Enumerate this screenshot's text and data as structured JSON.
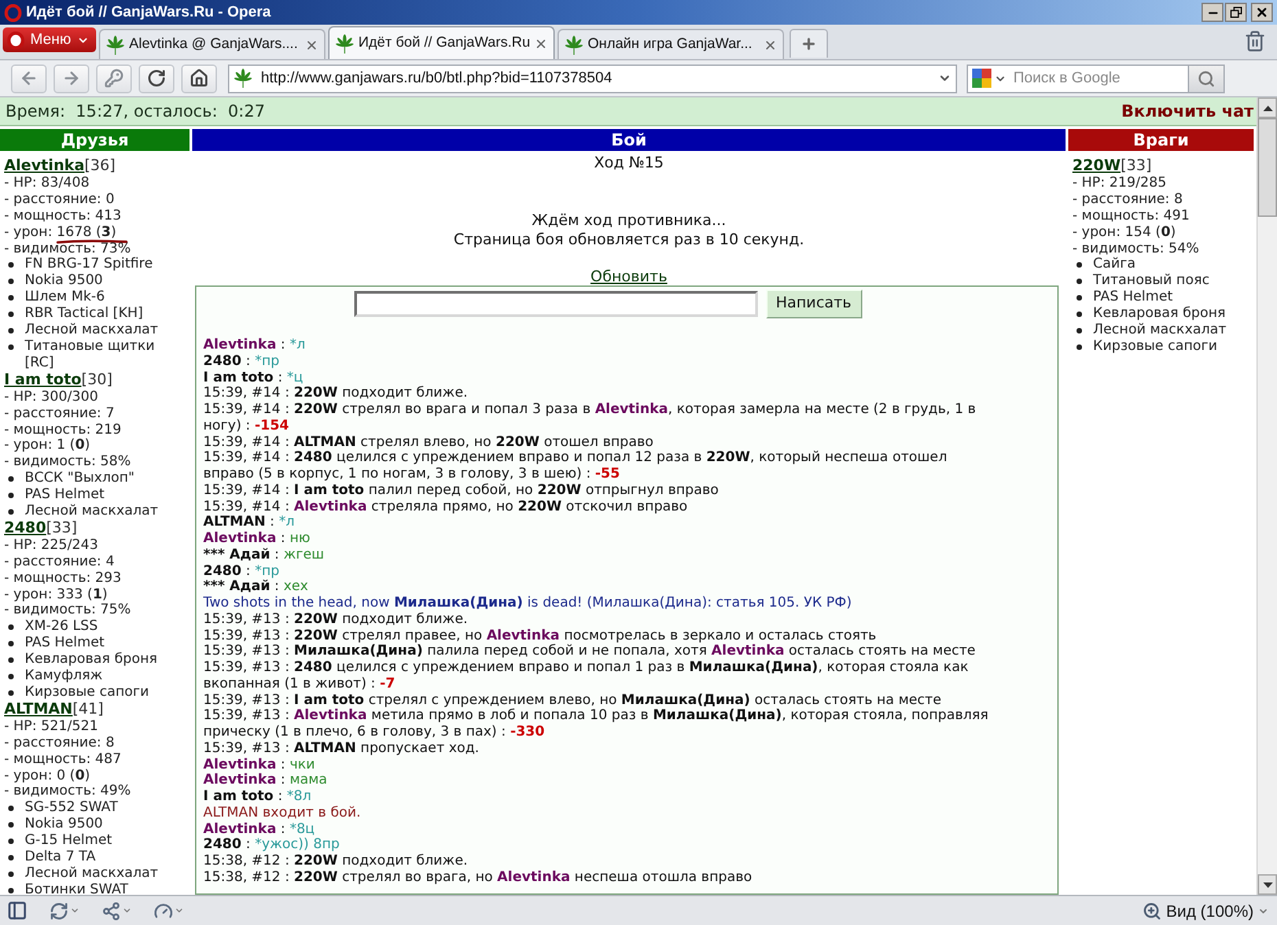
{
  "window": {
    "title": "Идёт бой // GanjaWars.Ru - Opera"
  },
  "menu_button": {
    "label": "Меню"
  },
  "tabs": [
    {
      "label": "Alevtinka @ GanjaWars....",
      "selected": false
    },
    {
      "label": "Идёт бой // GanjaWars.Ru",
      "selected": true
    },
    {
      "label": "Онлайн игра GanjaWar...",
      "selected": false
    }
  ],
  "address_bar": {
    "url": "http://www.ganjawars.ru/b0/btl.php?bid=1107378504"
  },
  "search": {
    "placeholder": "Поиск в Google"
  },
  "info_bar": {
    "timer": "Время:  15:27, осталось:  0:27",
    "chat_toggle": "Включить чат"
  },
  "friends": {
    "title": "Друзья",
    "players": [
      {
        "name": "Alevtinka",
        "level": "[36]",
        "stats": [
          {
            "text": "- HP: 83/408",
            "marked": false
          },
          {
            "text": "- расстояние: 0",
            "marked": false
          },
          {
            "text": "- мощность: 413",
            "marked": false
          },
          {
            "text": "- урон: 1678 (**3**)",
            "marked": true
          },
          {
            "text": "- видимость: 73%",
            "marked": false
          }
        ],
        "items": [
          "FN BRG-17 Spitfire",
          "Nokia 9500",
          "Шлем Mk-6",
          "RBR Tactical [KH]",
          "Лесной маскхалат",
          "Титановые щитки [RC]"
        ]
      },
      {
        "name": "I am toto",
        "level": "[30]",
        "stats": [
          {
            "text": "- HP: 300/300",
            "marked": false
          },
          {
            "text": "- расстояние: 7",
            "marked": false
          },
          {
            "text": "- мощность: 219",
            "marked": false
          },
          {
            "text": "- урон: 1 (**0**)",
            "marked": false
          },
          {
            "text": "- видимость: 58%",
            "marked": false
          }
        ],
        "items": [
          "ВССК \"Выхлоп\"",
          "PAS Helmet",
          "Лесной маскхалат"
        ]
      },
      {
        "name": "2480",
        "level": "[33]",
        "stats": [
          {
            "text": "- HP: 225/243",
            "marked": false
          },
          {
            "text": "- расстояние: 4",
            "marked": false
          },
          {
            "text": "- мощность: 293",
            "marked": false
          },
          {
            "text": "- урон: 333 (**1**)",
            "marked": false
          },
          {
            "text": "- видимость: 75%",
            "marked": false
          }
        ],
        "items": [
          "XM-26 LSS",
          "PAS Helmet",
          "Кевларовая броня",
          "Камуфляж",
          "Кирзовые сапоги"
        ]
      },
      {
        "name": "ALTMAN",
        "level": "[41]",
        "stats": [
          {
            "text": "- HP: 521/521",
            "marked": false
          },
          {
            "text": "- расстояние: 8",
            "marked": false
          },
          {
            "text": "- мощность: 487",
            "marked": false
          },
          {
            "text": "- урон: 0 (**0**)",
            "marked": false
          },
          {
            "text": "- видимость: 49%",
            "marked": false
          }
        ],
        "items": [
          "SG-552 SWAT",
          "Nokia 9500",
          "G-15 Helmet",
          "Delta 7 TA",
          "Лесной маскхалат",
          "Ботинки SWAT"
        ]
      }
    ]
  },
  "battle": {
    "title": "Бой",
    "turn": "Ход №15",
    "status": [
      "Ждём ход противника...",
      "Страница боя обновляется раз в 10 секунд."
    ],
    "refresh": "Обновить",
    "send_button": "Написать",
    "log": [
      {
        "segments": [
          {
            "kind": "player",
            "text": "Alevtinka"
          },
          {
            "kind": "plain",
            "text": " : "
          },
          {
            "kind": "command",
            "text": "*л"
          }
        ]
      },
      {
        "segments": [
          {
            "kind": "fighter",
            "text": "2480"
          },
          {
            "kind": "plain",
            "text": " : "
          },
          {
            "kind": "command",
            "text": "*пр"
          }
        ]
      },
      {
        "segments": [
          {
            "kind": "fighter",
            "text": "I am toto"
          },
          {
            "kind": "plain",
            "text": " : "
          },
          {
            "kind": "command",
            "text": "*ц"
          }
        ]
      },
      {
        "segments": [
          {
            "kind": "plain",
            "text": "15:39, #14 : "
          },
          {
            "kind": "fighter",
            "text": "220W"
          },
          {
            "kind": "plain",
            "text": " подходит ближе."
          }
        ]
      },
      {
        "segments": [
          {
            "kind": "plain",
            "text": "15:39, #14 : "
          },
          {
            "kind": "fighter",
            "text": "220W"
          },
          {
            "kind": "plain",
            "text": " стрелял во врага и попал 3 раза в "
          },
          {
            "kind": "player",
            "text": "Alevtinka"
          },
          {
            "kind": "plain",
            "text": ", которая замерла на месте (2 в грудь, 1 в ногу) : "
          },
          {
            "kind": "damage",
            "text": "-154"
          }
        ]
      },
      {
        "segments": [
          {
            "kind": "plain",
            "text": "15:39, #14 : "
          },
          {
            "kind": "fighter",
            "text": "ALTMAN"
          },
          {
            "kind": "plain",
            "text": " стрелял влево, но "
          },
          {
            "kind": "fighter",
            "text": "220W"
          },
          {
            "kind": "plain",
            "text": " отошел вправо"
          }
        ]
      },
      {
        "segments": [
          {
            "kind": "plain",
            "text": "15:39, #14 : "
          },
          {
            "kind": "fighter",
            "text": "2480"
          },
          {
            "kind": "plain",
            "text": " целился с упреждением вправо и попал 12 раза в "
          },
          {
            "kind": "fighter",
            "text": "220W"
          },
          {
            "kind": "plain",
            "text": ", который неспеша отошел вправо (5 в корпус, 1 по ногам, 3 в голову, 3 в шею) : "
          },
          {
            "kind": "damage",
            "text": "-55"
          }
        ]
      },
      {
        "segments": [
          {
            "kind": "plain",
            "text": "15:39, #14 : "
          },
          {
            "kind": "fighter",
            "text": "I am toto"
          },
          {
            "kind": "plain",
            "text": " палил перед собой, но "
          },
          {
            "kind": "fighter",
            "text": "220W"
          },
          {
            "kind": "plain",
            "text": " отпрыгнул вправо"
          }
        ]
      },
      {
        "segments": [
          {
            "kind": "plain",
            "text": "15:39, #14 : "
          },
          {
            "kind": "player",
            "text": "Alevtinka"
          },
          {
            "kind": "plain",
            "text": " стреляла прямо, но "
          },
          {
            "kind": "fighter",
            "text": "220W"
          },
          {
            "kind": "plain",
            "text": " отскочил вправо"
          }
        ]
      },
      {
        "segments": [
          {
            "kind": "fighter",
            "text": "ALTMAN"
          },
          {
            "kind": "plain",
            "text": " : "
          },
          {
            "kind": "command",
            "text": "*л"
          }
        ]
      },
      {
        "segments": [
          {
            "kind": "player",
            "text": "Alevtinka"
          },
          {
            "kind": "plain",
            "text": " : "
          },
          {
            "kind": "speech",
            "text": "ню"
          }
        ]
      },
      {
        "segments": [
          {
            "kind": "fighter",
            "text": "*** Адай"
          },
          {
            "kind": "plain",
            "text": " : "
          },
          {
            "kind": "speech",
            "text": "жгеш"
          }
        ]
      },
      {
        "segments": [
          {
            "kind": "fighter",
            "text": "2480"
          },
          {
            "kind": "plain",
            "text": " : "
          },
          {
            "kind": "command",
            "text": "*пр"
          }
        ]
      },
      {
        "segments": [
          {
            "kind": "fighter",
            "text": "*** Адай"
          },
          {
            "kind": "plain",
            "text": " : "
          },
          {
            "kind": "speech",
            "text": "хех"
          }
        ]
      },
      {
        "segments": [
          {
            "kind": "death",
            "text": "Two shots in the head, now "
          },
          {
            "kind": "victim",
            "text": "Милашка(Дина)"
          },
          {
            "kind": "death",
            "text": " is dead! (Милашка(Дина): статья 105. УК РФ)"
          }
        ]
      },
      {
        "segments": [
          {
            "kind": "plain",
            "text": "15:39, #13 : "
          },
          {
            "kind": "fighter",
            "text": "220W"
          },
          {
            "kind": "plain",
            "text": " подходит ближе."
          }
        ]
      },
      {
        "segments": [
          {
            "kind": "plain",
            "text": "15:39, #13 : "
          },
          {
            "kind": "fighter",
            "text": "220W"
          },
          {
            "kind": "plain",
            "text": " стрелял правее, но "
          },
          {
            "kind": "player",
            "text": "Alevtinka"
          },
          {
            "kind": "plain",
            "text": " посмотрелась в зеркало и осталась стоять"
          }
        ]
      },
      {
        "segments": [
          {
            "kind": "plain",
            "text": "15:39, #13 : "
          },
          {
            "kind": "fighter",
            "text": "Милашка(Дина)"
          },
          {
            "kind": "plain",
            "text": " палила перед собой и не попала, хотя "
          },
          {
            "kind": "player",
            "text": "Alevtinka"
          },
          {
            "kind": "plain",
            "text": " осталась стоять на месте"
          }
        ]
      },
      {
        "segments": [
          {
            "kind": "plain",
            "text": "15:39, #13 : "
          },
          {
            "kind": "fighter",
            "text": "2480"
          },
          {
            "kind": "plain",
            "text": " целился с упреждением вправо и попал 1 раз в "
          },
          {
            "kind": "fighter",
            "text": "Милашка(Дина)"
          },
          {
            "kind": "plain",
            "text": ", которая стояла как вкопанная (1 в живот) : "
          },
          {
            "kind": "damage",
            "text": "-7"
          }
        ]
      },
      {
        "segments": [
          {
            "kind": "plain",
            "text": "15:39, #13 : "
          },
          {
            "kind": "fighter",
            "text": "I am toto"
          },
          {
            "kind": "plain",
            "text": " стрелял с упреждением влево, но "
          },
          {
            "kind": "fighter",
            "text": "Милашка(Дина)"
          },
          {
            "kind": "plain",
            "text": " осталась стоять на месте"
          }
        ]
      },
      {
        "segments": [
          {
            "kind": "plain",
            "text": "15:39, #13 : "
          },
          {
            "kind": "player",
            "text": "Alevtinka"
          },
          {
            "kind": "plain",
            "text": " метила прямо в лоб и попала 10 раз в "
          },
          {
            "kind": "fighter",
            "text": "Милашка(Дина)"
          },
          {
            "kind": "plain",
            "text": ", которая стояла, поправляя прическу (1 в плечо, 6 в голову, 3 в пах) : "
          },
          {
            "kind": "damage",
            "text": "-330"
          }
        ]
      },
      {
        "segments": [
          {
            "kind": "plain",
            "text": "15:39, #13 : "
          },
          {
            "kind": "fighter",
            "text": "ALTMAN"
          },
          {
            "kind": "plain",
            "text": " пропускает ход."
          }
        ]
      },
      {
        "segments": [
          {
            "kind": "player",
            "text": "Alevtinka"
          },
          {
            "kind": "plain",
            "text": " : "
          },
          {
            "kind": "speech",
            "text": "чки"
          }
        ]
      },
      {
        "segments": [
          {
            "kind": "player",
            "text": "Alevtinka"
          },
          {
            "kind": "plain",
            "text": " : "
          },
          {
            "kind": "speech",
            "text": "мама"
          }
        ]
      },
      {
        "segments": [
          {
            "kind": "fighter",
            "text": "I am toto"
          },
          {
            "kind": "plain",
            "text": " : "
          },
          {
            "kind": "command",
            "text": "*8л"
          }
        ]
      },
      {
        "segments": [
          {
            "kind": "arrival",
            "text": "ALTMAN входит в бой."
          }
        ]
      },
      {
        "segments": [
          {
            "kind": "player",
            "text": "Alevtinka"
          },
          {
            "kind": "plain",
            "text": " : "
          },
          {
            "kind": "command",
            "text": "*8ц"
          }
        ]
      },
      {
        "segments": [
          {
            "kind": "fighter",
            "text": "2480"
          },
          {
            "kind": "plain",
            "text": " : "
          },
          {
            "kind": "command",
            "text": "*ужос)) 8пр"
          }
        ]
      },
      {
        "segments": [
          {
            "kind": "plain",
            "text": "15:38, #12 : "
          },
          {
            "kind": "fighter",
            "text": "220W"
          },
          {
            "kind": "plain",
            "text": " подходит ближе."
          }
        ]
      },
      {
        "segments": [
          {
            "kind": "plain",
            "text": "15:38, #12 : "
          },
          {
            "kind": "fighter",
            "text": "220W"
          },
          {
            "kind": "plain",
            "text": " стрелял во врага, но "
          },
          {
            "kind": "player",
            "text": "Alevtinka"
          },
          {
            "kind": "plain",
            "text": " неспеша отошла вправо"
          }
        ]
      }
    ]
  },
  "enemies": {
    "title": "Враги",
    "players": [
      {
        "name": "220W",
        "level": "[33]",
        "stats": [
          {
            "text": "- HP: 219/285",
            "marked": false
          },
          {
            "text": "- расстояние: 8",
            "marked": false
          },
          {
            "text": "- мощность: 491",
            "marked": false
          },
          {
            "text": "- урон: 154 (**0**)",
            "marked": false
          },
          {
            "text": "- видимость: 54%",
            "marked": false
          }
        ],
        "items": [
          "Сайга",
          "Титановый пояс",
          "PAS Helmet",
          "Кевларовая броня",
          "Лесной маскхалат",
          "Кирзовые сапоги"
        ]
      }
    ]
  },
  "status_bar": {
    "zoom": "Вид (100%)"
  }
}
